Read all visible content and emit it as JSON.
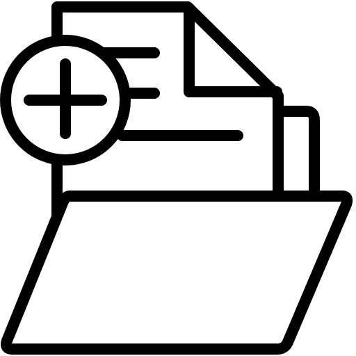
{
  "icon": {
    "name": "add-file-to-folder-icon",
    "stroke_color": "#000000",
    "fill_color": "#ffffff"
  }
}
